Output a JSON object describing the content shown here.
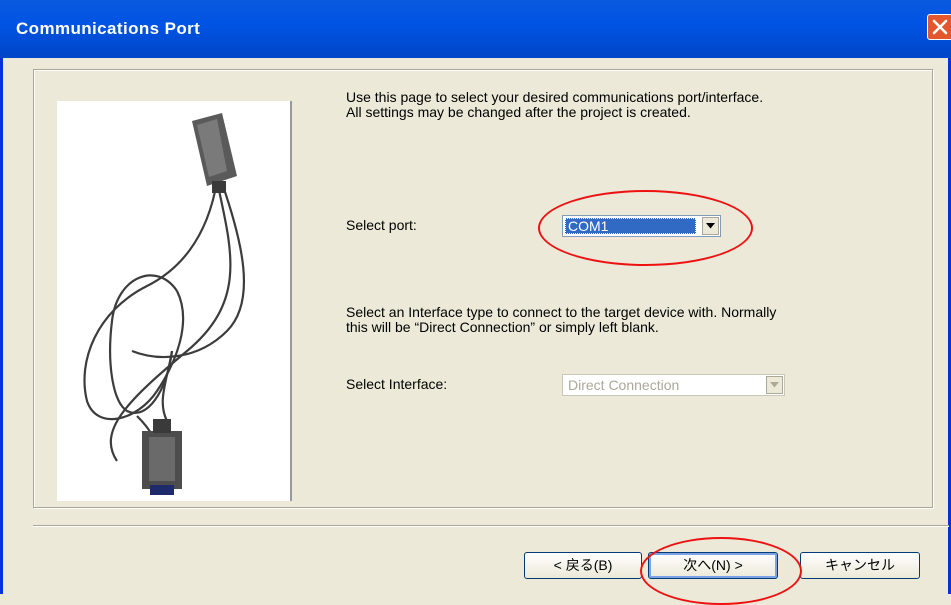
{
  "window": {
    "title": "Communications Port",
    "close_icon": "close-icon"
  },
  "image": {
    "icon": "serial-cable-image"
  },
  "page": {
    "description1_line1": "Use this page to select your desired communications port/interface.",
    "description1_line2": "All settings may be changed after the project is created.",
    "port_label": "Select port:",
    "port_value": "COM1",
    "description2_line1": "Select an Interface type to connect to the target device with. Normally",
    "description2_line2": "this will be “Direct Connection” or simply left blank.",
    "interface_label": "Select Interface:",
    "interface_value": "Direct Connection"
  },
  "buttons": {
    "back": "< 戻る(B)",
    "next": "次へ(N) >",
    "cancel": "キャンセル"
  },
  "colors": {
    "titlebar": "#0054e3",
    "highlight": "#316ac5",
    "annotation": "#e11111"
  }
}
